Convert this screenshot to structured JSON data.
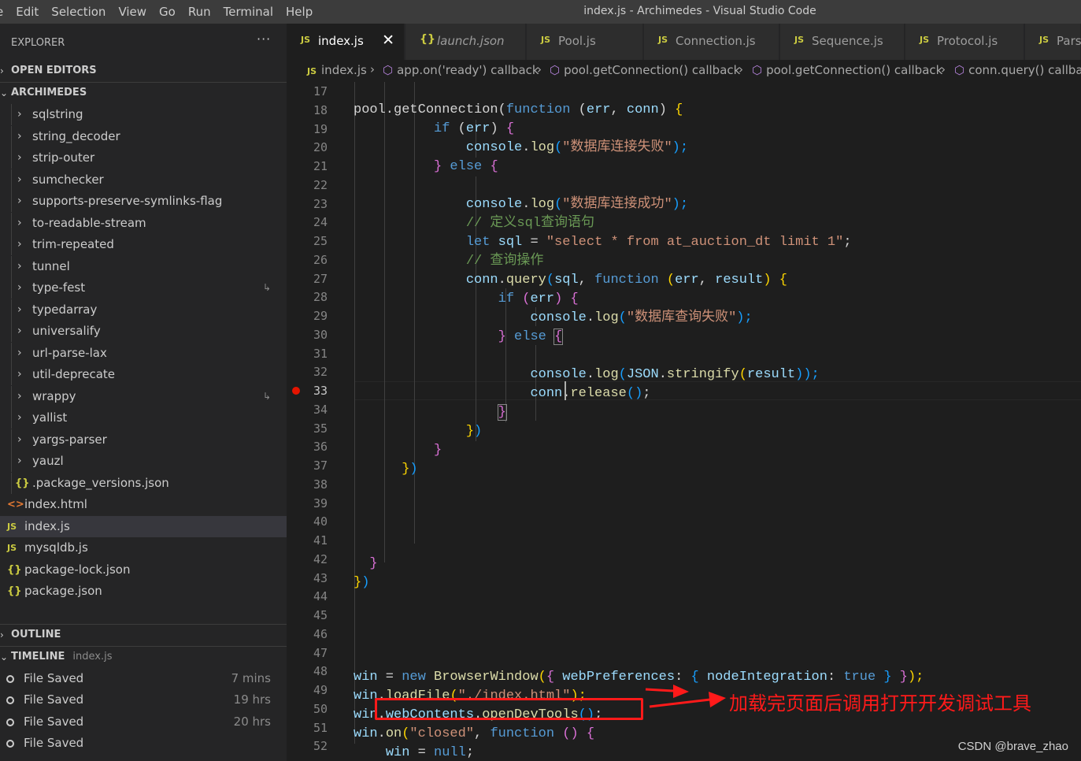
{
  "menubar": {
    "items": [
      "e",
      "Edit",
      "Selection",
      "View",
      "Go",
      "Run",
      "Terminal",
      "Help"
    ],
    "window_title": "index.js - Archimedes - Visual Studio Code"
  },
  "sidebar": {
    "title": "EXPLORER",
    "more_label": "···",
    "open_editors": "OPEN EDITORS",
    "project": "ARCHIMEDES",
    "folders": [
      "sqlstring",
      "string_decoder",
      "strip-outer",
      "sumchecker",
      "supports-preserve-symlinks-flag",
      "to-readable-stream",
      "trim-repeated",
      "tunnel",
      "type-fest",
      "typedarray",
      "universalify",
      "url-parse-lax",
      "util-deprecate",
      "wrappy",
      "yallist",
      "yargs-parser",
      "yauzl"
    ],
    "files": [
      {
        "name": ".package_versions.json",
        "icon": "json-braces-icon"
      },
      {
        "name": "index.html",
        "icon": "html-icon"
      },
      {
        "name": "index.js",
        "icon": "js-icon"
      },
      {
        "name": "mysqldb.js",
        "icon": "js-icon"
      },
      {
        "name": "package-lock.json",
        "icon": "json-braces-icon"
      },
      {
        "name": "package.json",
        "icon": "json-braces-icon"
      }
    ],
    "outline": "OUTLINE",
    "timeline": "TIMELINE",
    "timeline_file": "index.js",
    "timeline_items": [
      {
        "label": "File Saved",
        "time": "7 mins"
      },
      {
        "label": "File Saved",
        "time": "19 hrs"
      },
      {
        "label": "File Saved",
        "time": "20 hrs"
      },
      {
        "label": "File Saved",
        "time": ""
      }
    ]
  },
  "tabs": [
    {
      "label": "index.js",
      "icon": "JS"
    },
    {
      "label": "launch.json",
      "icon": "{}"
    },
    {
      "label": "Pool.js",
      "icon": "JS"
    },
    {
      "label": "Connection.js",
      "icon": "JS"
    },
    {
      "label": "Sequence.js",
      "icon": "JS"
    },
    {
      "label": "Protocol.js",
      "icon": "JS"
    },
    {
      "label": "Pars",
      "icon": "JS"
    }
  ],
  "breadcrumb": [
    "index.js",
    "app.on('ready') callback",
    "pool.getConnection() callback",
    "pool.getConnection() callback",
    "conn.query() callbac"
  ],
  "editor": {
    "line_numbers": [
      "17",
      "18",
      "19",
      "20",
      "21",
      "22",
      "23",
      "24",
      "25",
      "26",
      "27",
      "28",
      "29",
      "30",
      "31",
      "32",
      "33",
      "34",
      "35",
      "36",
      "37",
      "38",
      "39",
      "40",
      "41",
      "42",
      "43",
      "44",
      "45",
      "46",
      "47",
      "48",
      "49",
      "50",
      "51",
      "52"
    ],
    "code": {
      "l18a": "pool.getConnection(",
      "l18b": "function",
      "l18c": " (",
      "l18d": "err",
      "l18e": ", ",
      "l18f": "conn",
      "l18g": ") ",
      "l18h": "{",
      "l19a": "if",
      "l19b": " (",
      "l19c": "err",
      "l19d": ") ",
      "l19e": "{",
      "l20a": "console",
      "l20b": ".",
      "l20c": "log",
      "l20d": "(",
      "l20e": "\"数据库连接失败\"",
      "l20f": ");",
      "l21a": "}",
      "l21b": " else ",
      "l21c": "{",
      "l23a": "console",
      "l23b": ".",
      "l23c": "log",
      "l23d": "(",
      "l23e": "\"数据库连接成功\"",
      "l23f": ");",
      "l24": "// 定义sql查询语句",
      "l25a": "let",
      "l25b": " sql",
      "l25c": " = ",
      "l25d": "\"select * from at_auction_dt limit 1\"",
      "l25e": ";",
      "l26": "// 查询操作",
      "l27a": "conn",
      "l27b": ".",
      "l27c": "query",
      "l27d": "(",
      "l27e": "sql",
      "l27f": ", ",
      "l27g": "function",
      "l27h": " (",
      "l27i": "err",
      "l27j": ", ",
      "l27k": "result",
      "l27l": ") ",
      "l27m": "{",
      "l28a": "if",
      "l28b": " (",
      "l28c": "err",
      "l28d": ") ",
      "l28e": "{",
      "l29a": "console",
      "l29b": ".",
      "l29c": "log",
      "l29d": "(",
      "l29e": "\"数据库查询失败\"",
      "l29f": ");",
      "l30a": "}",
      "l30b": " else ",
      "l30c": "{",
      "l32a": "console",
      "l32b": ".",
      "l32c": "log",
      "l32d": "(",
      "l32e": "JSON",
      "l32f": ".",
      "l32g": "stringify",
      "l32h": "(",
      "l32i": "result",
      "l32j": "));",
      "l33a": "conn",
      "l33b": ".",
      "l33c": "release",
      "l33d": "()",
      "l33e": ";",
      "l34": "}",
      "l35a": "}",
      "l35b": ")",
      "l36": "}",
      "l37a": "}",
      "l37b": ")",
      "l42": "}",
      "l43a": "}",
      "l43b": ")",
      "l48a": "win",
      "l48b": " = ",
      "l48c": "new",
      "l48d": " BrowserWindow",
      "l48e": "(",
      "l48f": "{",
      "l48g": " webPreferences",
      "l48h": ": ",
      "l48i": "{",
      "l48j": " nodeIntegration",
      "l48k": ": ",
      "l48l": "true",
      "l48m": " }",
      "l48n": " }",
      "l48o": ");",
      "l49a": "win",
      "l49b": ".",
      "l49c": "loadFile",
      "l49d": "(",
      "l49e": "\"./index.html\"",
      "l49f": ");",
      "l50a": "win",
      "l50b": ".",
      "l50c": "webContents",
      "l50d": ".",
      "l50e": "openDevTools",
      "l50f": "()",
      "l50g": ";",
      "l51a": "win",
      "l51b": ".",
      "l51c": "on",
      "l51d": "(",
      "l51e": "\"closed\"",
      "l51f": ", ",
      "l51g": "function",
      "l51h": " ()",
      "l51i": " {",
      "l52a": "win",
      "l52b": " = ",
      "l52c": "null",
      "l52d": ";"
    }
  },
  "annotation": {
    "text": "加载完页面后调用打开开发调试工具",
    "color": "#ff1a1a"
  },
  "watermark": "CSDN @brave_zhao"
}
